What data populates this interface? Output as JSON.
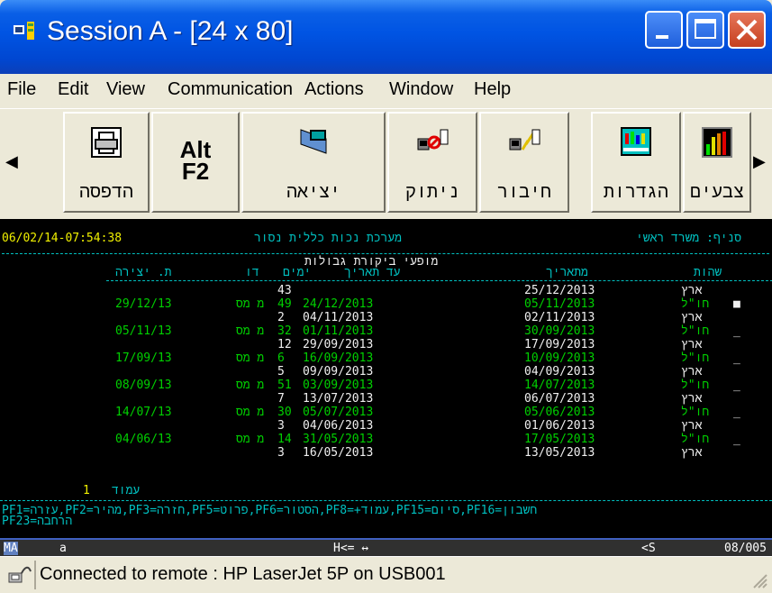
{
  "window": {
    "title": "Session A - [24 x 80]"
  },
  "menu": [
    "File",
    "Edit",
    "View",
    "Communication",
    "Actions",
    "Window",
    "Help"
  ],
  "toolbar": {
    "buttons": [
      {
        "label": "הדפסה",
        "icon": "printer-icon"
      },
      {
        "label": "Alt F2",
        "icon": "alt-f2-text"
      },
      {
        "label": "יציאה",
        "icon": "exit-icon"
      },
      {
        "label": "ניתוק",
        "icon": "disconnect-icon"
      },
      {
        "label": "חיבור",
        "icon": "connect-icon"
      },
      {
        "label": "הגדרות",
        "icon": "settings-icon"
      },
      {
        "label": "צבעים",
        "icon": "colors-icon"
      }
    ],
    "alt_line1": "Alt",
    "alt_line2": "F2"
  },
  "terminal": {
    "header_datetime": "06/02/14-07:54:38",
    "header_system": "מערכת נכות כללית נסור",
    "header_branch": "סניף: משרד ראשי",
    "screen_title": "מופעי ביקורת גבולות",
    "columns": {
      "creation_date": "ת. יצירה",
      "dr": "דו",
      "days": "ימים",
      "to_date": "עד תאריך",
      "from_date": "מתאריך",
      "status": "שהות"
    },
    "rows": [
      {
        "creation": "",
        "dr": "",
        "days": "43",
        "to_date": "",
        "from_date": "25/12/2013",
        "status": "ארץ",
        "color": "white",
        "cursor": ""
      },
      {
        "creation": "29/12/13",
        "dr": "מ מס",
        "days": "49",
        "to_date": "24/12/2013",
        "from_date": "05/11/2013",
        "status": "חו\"ל",
        "color": "green",
        "cursor": "■"
      },
      {
        "creation": "",
        "dr": "",
        "days": "2",
        "to_date": "04/11/2013",
        "from_date": "02/11/2013",
        "status": "ארץ",
        "color": "white",
        "cursor": ""
      },
      {
        "creation": "05/11/13",
        "dr": "מ מס",
        "days": "32",
        "to_date": "01/11/2013",
        "from_date": "30/09/2013",
        "status": "חו\"ל",
        "color": "green",
        "cursor": "_"
      },
      {
        "creation": "",
        "dr": "",
        "days": "12",
        "to_date": "29/09/2013",
        "from_date": "17/09/2013",
        "status": "ארץ",
        "color": "white",
        "cursor": ""
      },
      {
        "creation": "17/09/13",
        "dr": "מ מס",
        "days": "6",
        "to_date": "16/09/2013",
        "from_date": "10/09/2013",
        "status": "חו\"ל",
        "color": "green",
        "cursor": "_"
      },
      {
        "creation": "",
        "dr": "",
        "days": "5",
        "to_date": "09/09/2013",
        "from_date": "04/09/2013",
        "status": "ארץ",
        "color": "white",
        "cursor": ""
      },
      {
        "creation": "08/09/13",
        "dr": "מ מס",
        "days": "51",
        "to_date": "03/09/2013",
        "from_date": "14/07/2013",
        "status": "חו\"ל",
        "color": "green",
        "cursor": "_"
      },
      {
        "creation": "",
        "dr": "",
        "days": "7",
        "to_date": "13/07/2013",
        "from_date": "06/07/2013",
        "status": "ארץ",
        "color": "white",
        "cursor": ""
      },
      {
        "creation": "14/07/13",
        "dr": "מ מס",
        "days": "30",
        "to_date": "05/07/2013",
        "from_date": "05/06/2013",
        "status": "חו\"ל",
        "color": "green",
        "cursor": "_"
      },
      {
        "creation": "",
        "dr": "",
        "days": "3",
        "to_date": "04/06/2013",
        "from_date": "01/06/2013",
        "status": "ארץ",
        "color": "white",
        "cursor": ""
      },
      {
        "creation": "04/06/13",
        "dr": "מ מס",
        "days": "14",
        "to_date": "31/05/2013",
        "from_date": "17/05/2013",
        "status": "חו\"ל",
        "color": "green",
        "cursor": "_"
      },
      {
        "creation": "",
        "dr": "",
        "days": "3",
        "to_date": "16/05/2013",
        "from_date": "13/05/2013",
        "status": "ארץ",
        "color": "white",
        "cursor": ""
      }
    ],
    "page_number": "1",
    "page_label": "עמוד",
    "fkeys_line1": "PF1=עזרה,PF2=מהיר,PF3=חזרה,PF5=פרוט,PF6=הסטור,PF8=+עמוד,PF15=סיום,PF16=חשבון",
    "fkeys_line2": "PF23=הרחבה"
  },
  "oia": {
    "left": "MA",
    "session_letter": "a",
    "middle": "H<= ↔",
    "right_left": "<S",
    "right": "08/005"
  },
  "status": {
    "text": "Connected to remote : HP LaserJet 5P on USB001"
  },
  "colors": {
    "titlebar": "#0054e3",
    "terminal_bg": "#000000",
    "terminal_cyan": "#00c0c0",
    "terminal_green": "#00d000"
  }
}
